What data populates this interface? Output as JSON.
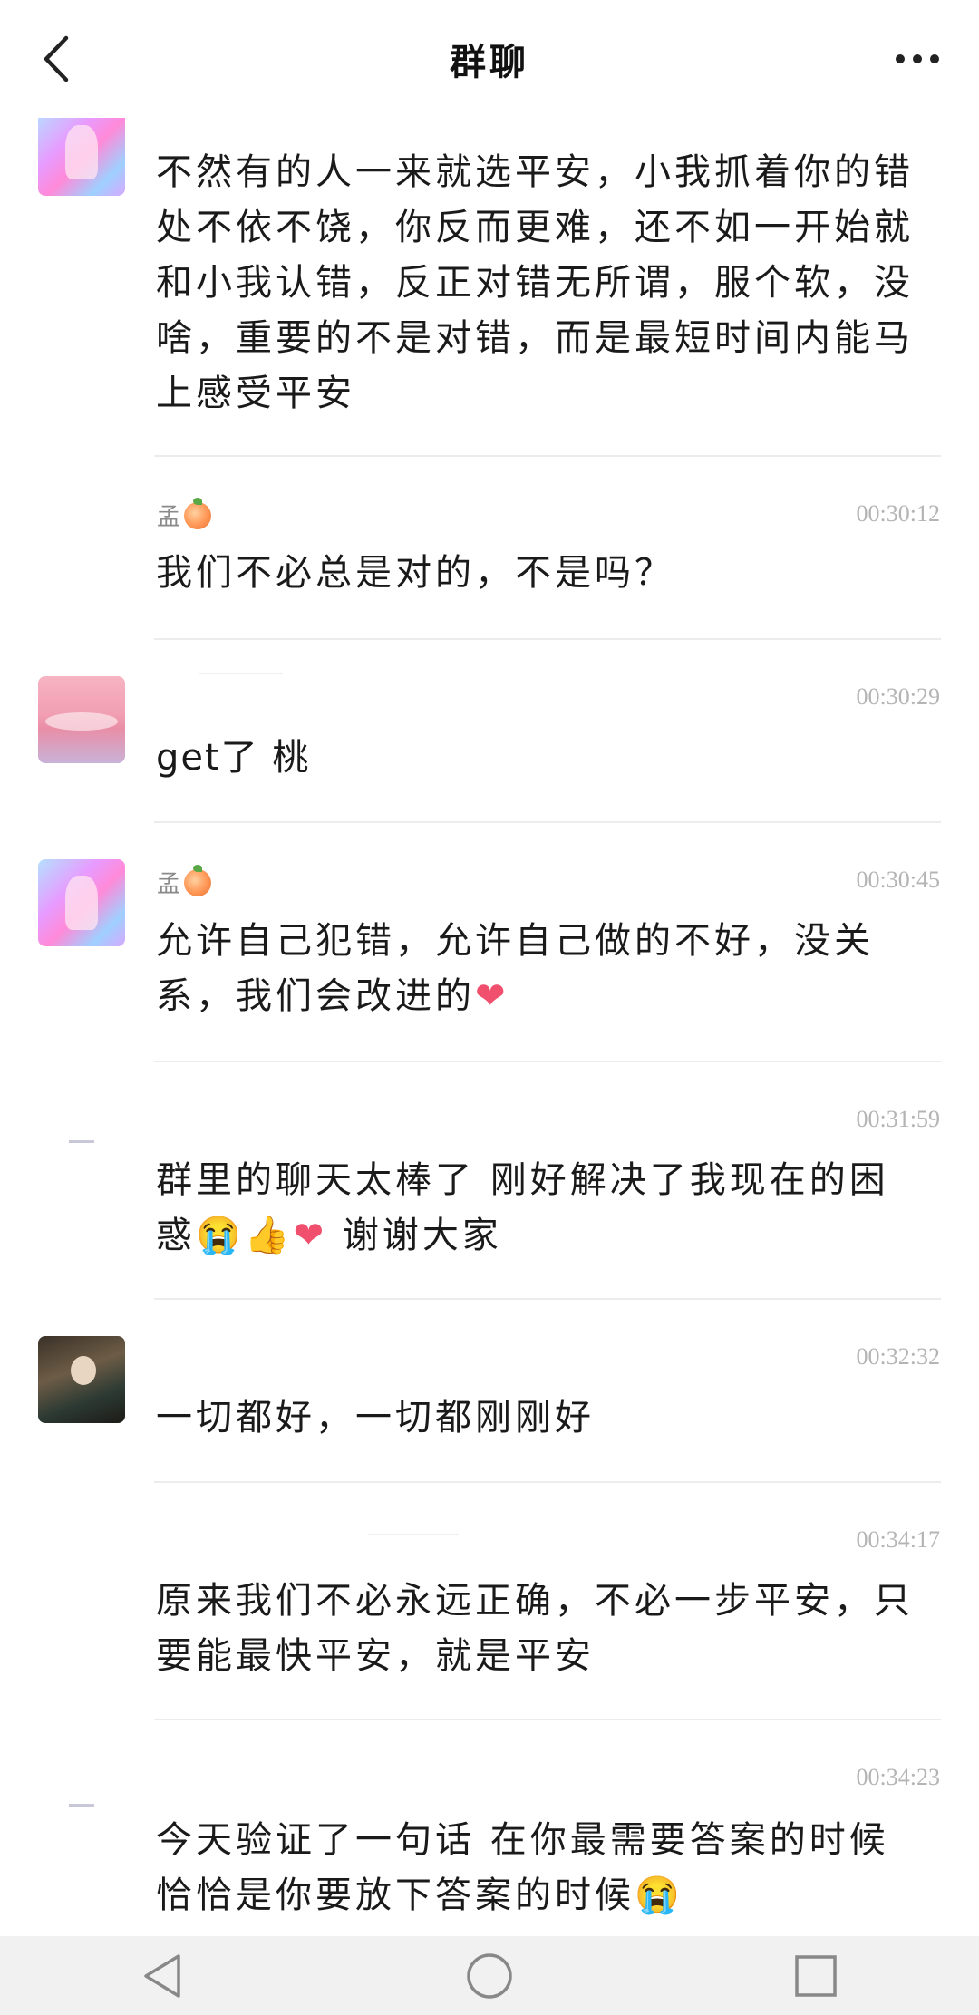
{
  "header": {
    "title": "群聊",
    "back_icon": "chevron-left-icon",
    "more_icon": "more-dots-icon"
  },
  "messages": [
    {
      "sender": "孟",
      "sender_emoji": "peach-icon",
      "time": "",
      "text": "不然有的人一来就选平安，小我抓着你的错处不依不饶，你反而更难，还不如一开始就和小我认错，反正对错无所谓，服个软，没啥，重要的不是对错，而是最短时间内能马上感受平安"
    },
    {
      "sender": "孟",
      "sender_emoji": "peach-icon",
      "time": "00:30:12",
      "text": "我们不必总是对的，不是吗？"
    },
    {
      "sender": "",
      "time": "00:30:29",
      "text": "get了 桃"
    },
    {
      "sender": "孟",
      "sender_emoji": "peach-icon",
      "time": "00:30:45",
      "text": "允许自己犯错，允许自己做的不好，没关系，我们会改进的",
      "trailing_emojis": [
        "heart-icon"
      ]
    },
    {
      "sender": "",
      "time": "00:31:59",
      "text_line1": "群里的聊天太棒了 刚好解决了我现在的困",
      "text_line2_start": "惑",
      "text_line2_end": " 谢谢大家",
      "inline_emojis": [
        "crying-face-icon",
        "thumbs-up-icon",
        "heart-icon"
      ]
    },
    {
      "sender": "",
      "time": "00:32:32",
      "text": "一切都好，一切都刚刚好"
    },
    {
      "sender": "",
      "time": "00:34:17",
      "text": "原来我们不必永远正确，不必一步平安，只要能最快平安，就是平安"
    },
    {
      "sender": "",
      "time": "00:34:23",
      "text": "今天验证了一句话 在你最需要答案的时候恰恰是你要放下答案的时候",
      "trailing_emojis": [
        "crying-face-icon"
      ]
    }
  ],
  "navbar": {
    "back": "triangle-back-icon",
    "home": "circle-home-icon",
    "recents": "square-recents-icon"
  }
}
